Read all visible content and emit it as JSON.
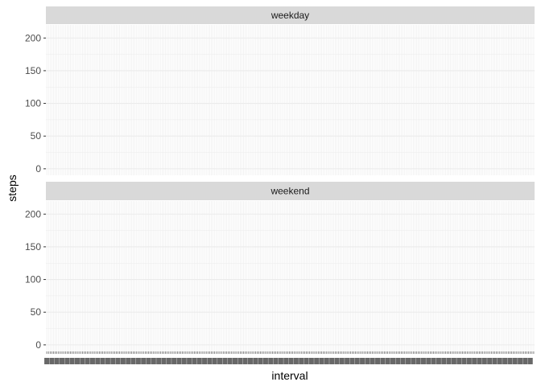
{
  "chart_data": {
    "type": "line",
    "facets": [
      "weekday",
      "weekend"
    ],
    "xlabel": "interval",
    "ylabel": "steps",
    "ylim": [
      -10,
      220
    ],
    "yticks": [
      0,
      50,
      100,
      150,
      200
    ],
    "x_categories_count": 288,
    "x_tick_labels_legible": false,
    "grid": true,
    "colors": {
      "panel_background": "#ffffff",
      "grid": "#ebebeb",
      "strip_background": "#d9d9d9",
      "tick_mark": "#333333"
    }
  }
}
